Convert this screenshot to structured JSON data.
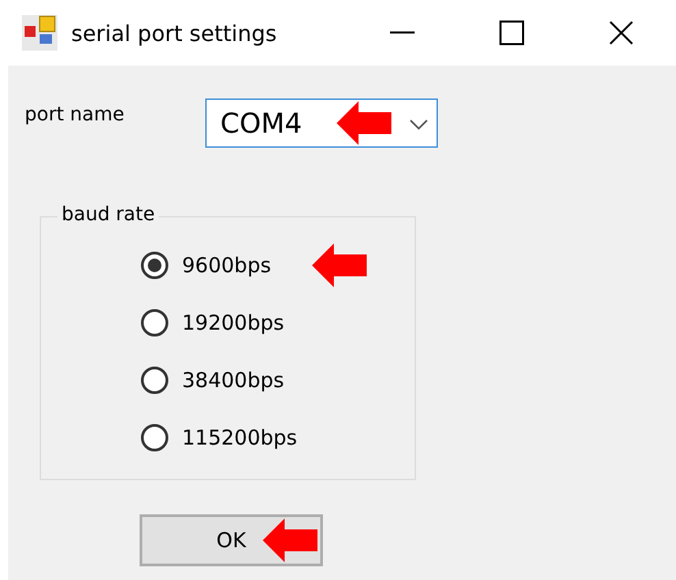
{
  "window": {
    "title": "serial port settings"
  },
  "port_name": {
    "label": "port name",
    "value": "COM4"
  },
  "baud_rate": {
    "label": "baud rate",
    "options": [
      {
        "label": "9600bps",
        "selected": true
      },
      {
        "label": "19200bps",
        "selected": false
      },
      {
        "label": "38400bps",
        "selected": false
      },
      {
        "label": "115200bps",
        "selected": false
      }
    ]
  },
  "ok_button": {
    "label": "OK"
  }
}
